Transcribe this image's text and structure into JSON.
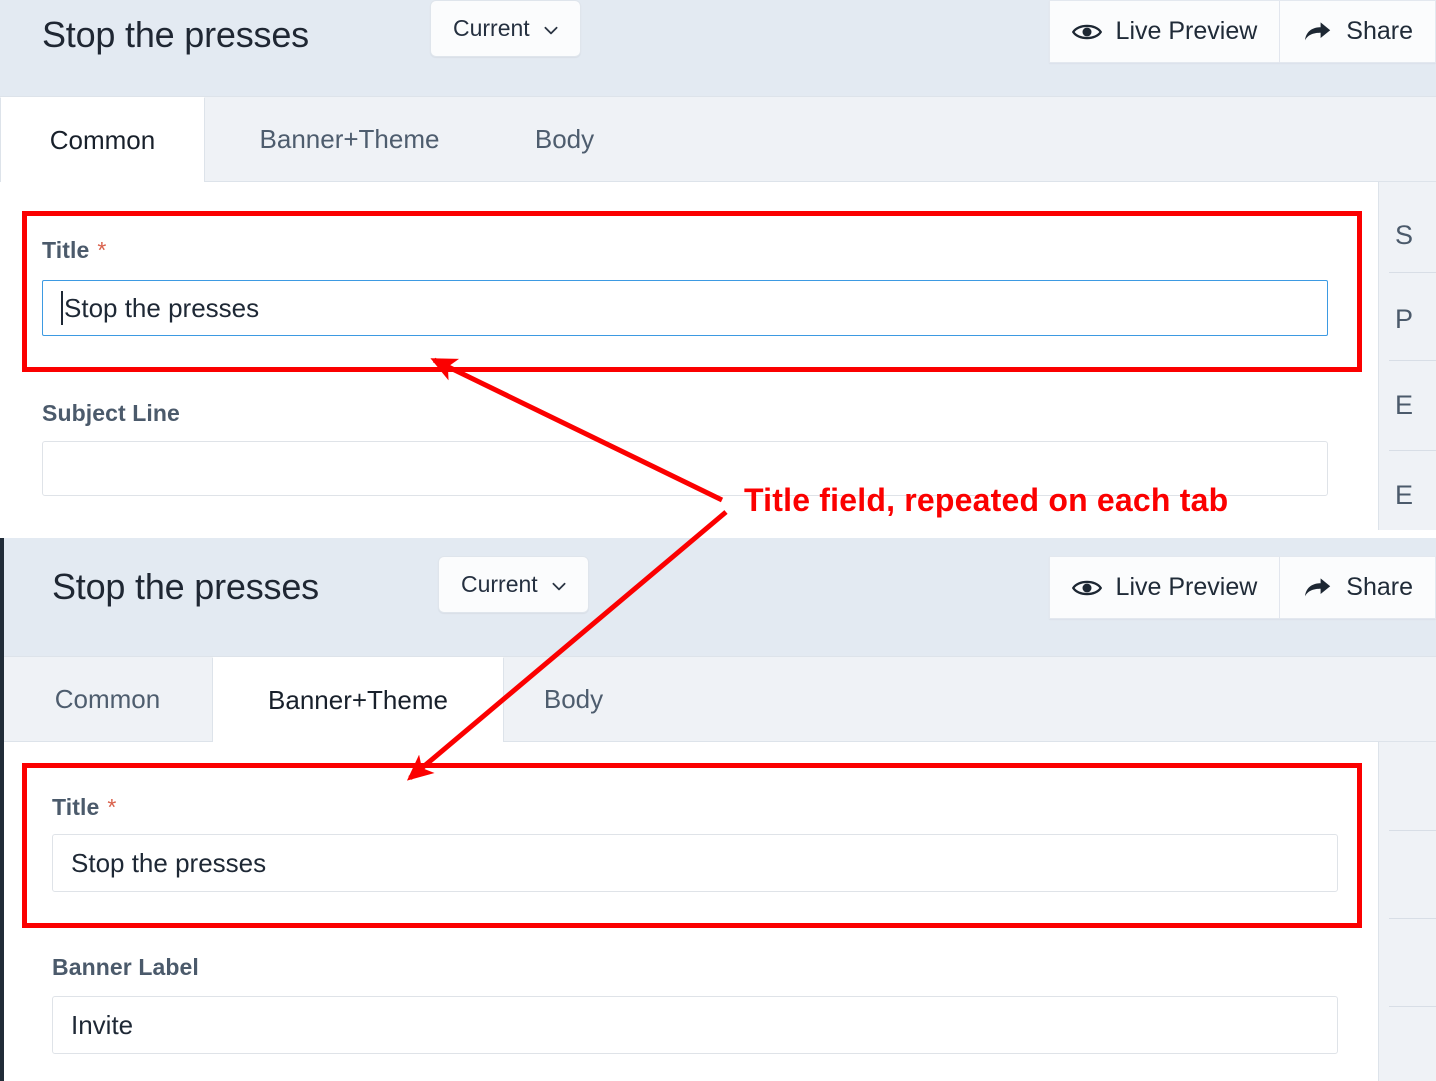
{
  "annotations": {
    "callout_text": "Title field, repeated on each tab",
    "color": "#fb0000"
  },
  "panel_top": {
    "header": {
      "title": "Stop the presses",
      "version_chip": {
        "label": "Current",
        "icon": "chevron-down-icon"
      },
      "actions": [
        {
          "label": "Live Preview",
          "icon": "eye-icon"
        },
        {
          "label": "Share",
          "icon": "share-arrow-icon"
        }
      ]
    },
    "tabs": [
      {
        "label": "Common",
        "active": true
      },
      {
        "label": "Banner+Theme",
        "active": false
      },
      {
        "label": "Body",
        "active": false
      }
    ],
    "fields": [
      {
        "label": "Title",
        "required_marker": "*",
        "value": "Stop the presses",
        "focused": true
      },
      {
        "label": "Subject Line",
        "required_marker": "",
        "value": "",
        "focused": false
      }
    ],
    "rail_items": [
      "S",
      "P",
      "E",
      "E"
    ]
  },
  "panel_bottom": {
    "header": {
      "title": "Stop the presses",
      "version_chip": {
        "label": "Current",
        "icon": "chevron-down-icon"
      },
      "actions": [
        {
          "label": "Live Preview",
          "icon": "eye-icon"
        },
        {
          "label": "Share",
          "icon": "share-arrow-icon"
        }
      ]
    },
    "tabs": [
      {
        "label": "Common",
        "active": false
      },
      {
        "label": "Banner+Theme",
        "active": true
      },
      {
        "label": "Body",
        "active": false
      }
    ],
    "fields": [
      {
        "label": "Title",
        "required_marker": "*",
        "value": "Stop the presses",
        "focused": false
      },
      {
        "label": "Banner Label",
        "required_marker": "",
        "value": "Invite",
        "focused": false
      }
    ],
    "rail_items": [
      "",
      "",
      "",
      ""
    ]
  },
  "theme": {
    "header_bg": "#e3eaf2",
    "tabbar_bg": "#eff2f6",
    "panel_bg": "#ffffff",
    "label_color": "#4b5a6b",
    "required_color": "#d9614c",
    "focus_border": "#3d9ae2",
    "dark_edge": "#212c38"
  }
}
